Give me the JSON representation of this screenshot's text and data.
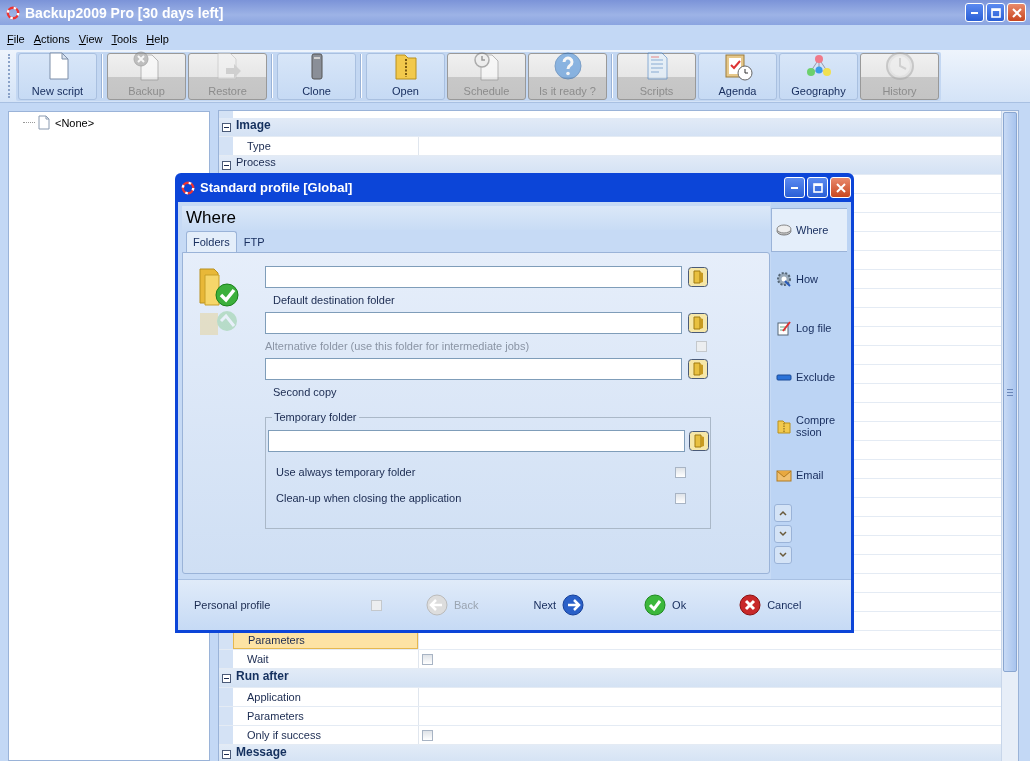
{
  "window": {
    "title": "Backup2009 Pro [30 days left]"
  },
  "menu": [
    {
      "label": "File"
    },
    {
      "label": "Actions"
    },
    {
      "label": "View"
    },
    {
      "label": "Tools"
    },
    {
      "label": "Help"
    }
  ],
  "toolbar": {
    "groups": [
      {
        "buttons": [
          {
            "label": "New script",
            "disabled": false
          }
        ]
      },
      {
        "buttons": [
          {
            "label": "Backup",
            "disabled": true
          },
          {
            "label": "Restore",
            "disabled": true
          }
        ]
      },
      {
        "buttons": [
          {
            "label": "Clone",
            "disabled": false
          }
        ]
      },
      {
        "buttons": [
          {
            "label": "Open",
            "disabled": false
          },
          {
            "label": "Schedule",
            "disabled": true
          },
          {
            "label": "Is it ready ?",
            "disabled": true
          }
        ]
      },
      {
        "buttons": [
          {
            "label": "Scripts",
            "disabled": true
          },
          {
            "label": "Agenda",
            "disabled": false
          },
          {
            "label": "Geography",
            "disabled": false
          },
          {
            "label": "History",
            "disabled": true
          }
        ]
      }
    ]
  },
  "tree": {
    "items": [
      {
        "label": "<None>"
      }
    ]
  },
  "property_grid": {
    "rows_top": [
      {
        "kind": "category",
        "label": "Image",
        "expanded": true
      },
      {
        "kind": "property",
        "label": "Type",
        "selected": false
      },
      {
        "kind": "group",
        "label": "Process",
        "expanded": true
      }
    ],
    "rows_bottom": [
      {
        "kind": "property",
        "label": "Parameters",
        "selected": true
      },
      {
        "kind": "property",
        "label": "Wait",
        "selected": false,
        "checked": false
      },
      {
        "kind": "category",
        "label": "Run after",
        "expanded": true
      },
      {
        "kind": "property",
        "label": "Application",
        "selected": false
      },
      {
        "kind": "property",
        "label": "Parameters",
        "selected": false
      },
      {
        "kind": "property",
        "label": "Only if success",
        "selected": false,
        "checked": false
      },
      {
        "kind": "category",
        "label": "Message",
        "expanded": true
      }
    ]
  },
  "dialog": {
    "title": "Standard profile [Global]",
    "heading": "Where",
    "tabs": [
      {
        "label": "Folders",
        "selected": true
      },
      {
        "label": "FTP",
        "selected": false
      }
    ],
    "fields": [
      {
        "label": "Default destination folder",
        "disabled": false
      },
      {
        "label": "Alternative folder (use this folder for intermediate jobs)",
        "disabled": true,
        "checked": false
      },
      {
        "label": "Second copy",
        "disabled": false
      }
    ],
    "temporary_folder": {
      "title": "Temporary folder",
      "options": [
        {
          "label": "Use always temporary folder",
          "checked": false
        },
        {
          "label": "Clean-up when closing the application",
          "checked": false
        }
      ]
    },
    "nav": [
      {
        "label": "Where",
        "selected": true
      },
      {
        "label": "How",
        "selected": false
      },
      {
        "label": "Log file",
        "selected": false
      },
      {
        "label": "Exclude",
        "selected": false
      },
      {
        "label": "Compression",
        "selected": false
      },
      {
        "label": "Email",
        "selected": false
      }
    ],
    "personal_profile": {
      "label": "Personal profile",
      "checked": false
    },
    "buttons": [
      {
        "label": "Back",
        "disabled": true
      },
      {
        "label": "Next",
        "disabled": false
      },
      {
        "label": "Ok",
        "disabled": false
      },
      {
        "label": "Cancel",
        "disabled": false
      }
    ]
  }
}
